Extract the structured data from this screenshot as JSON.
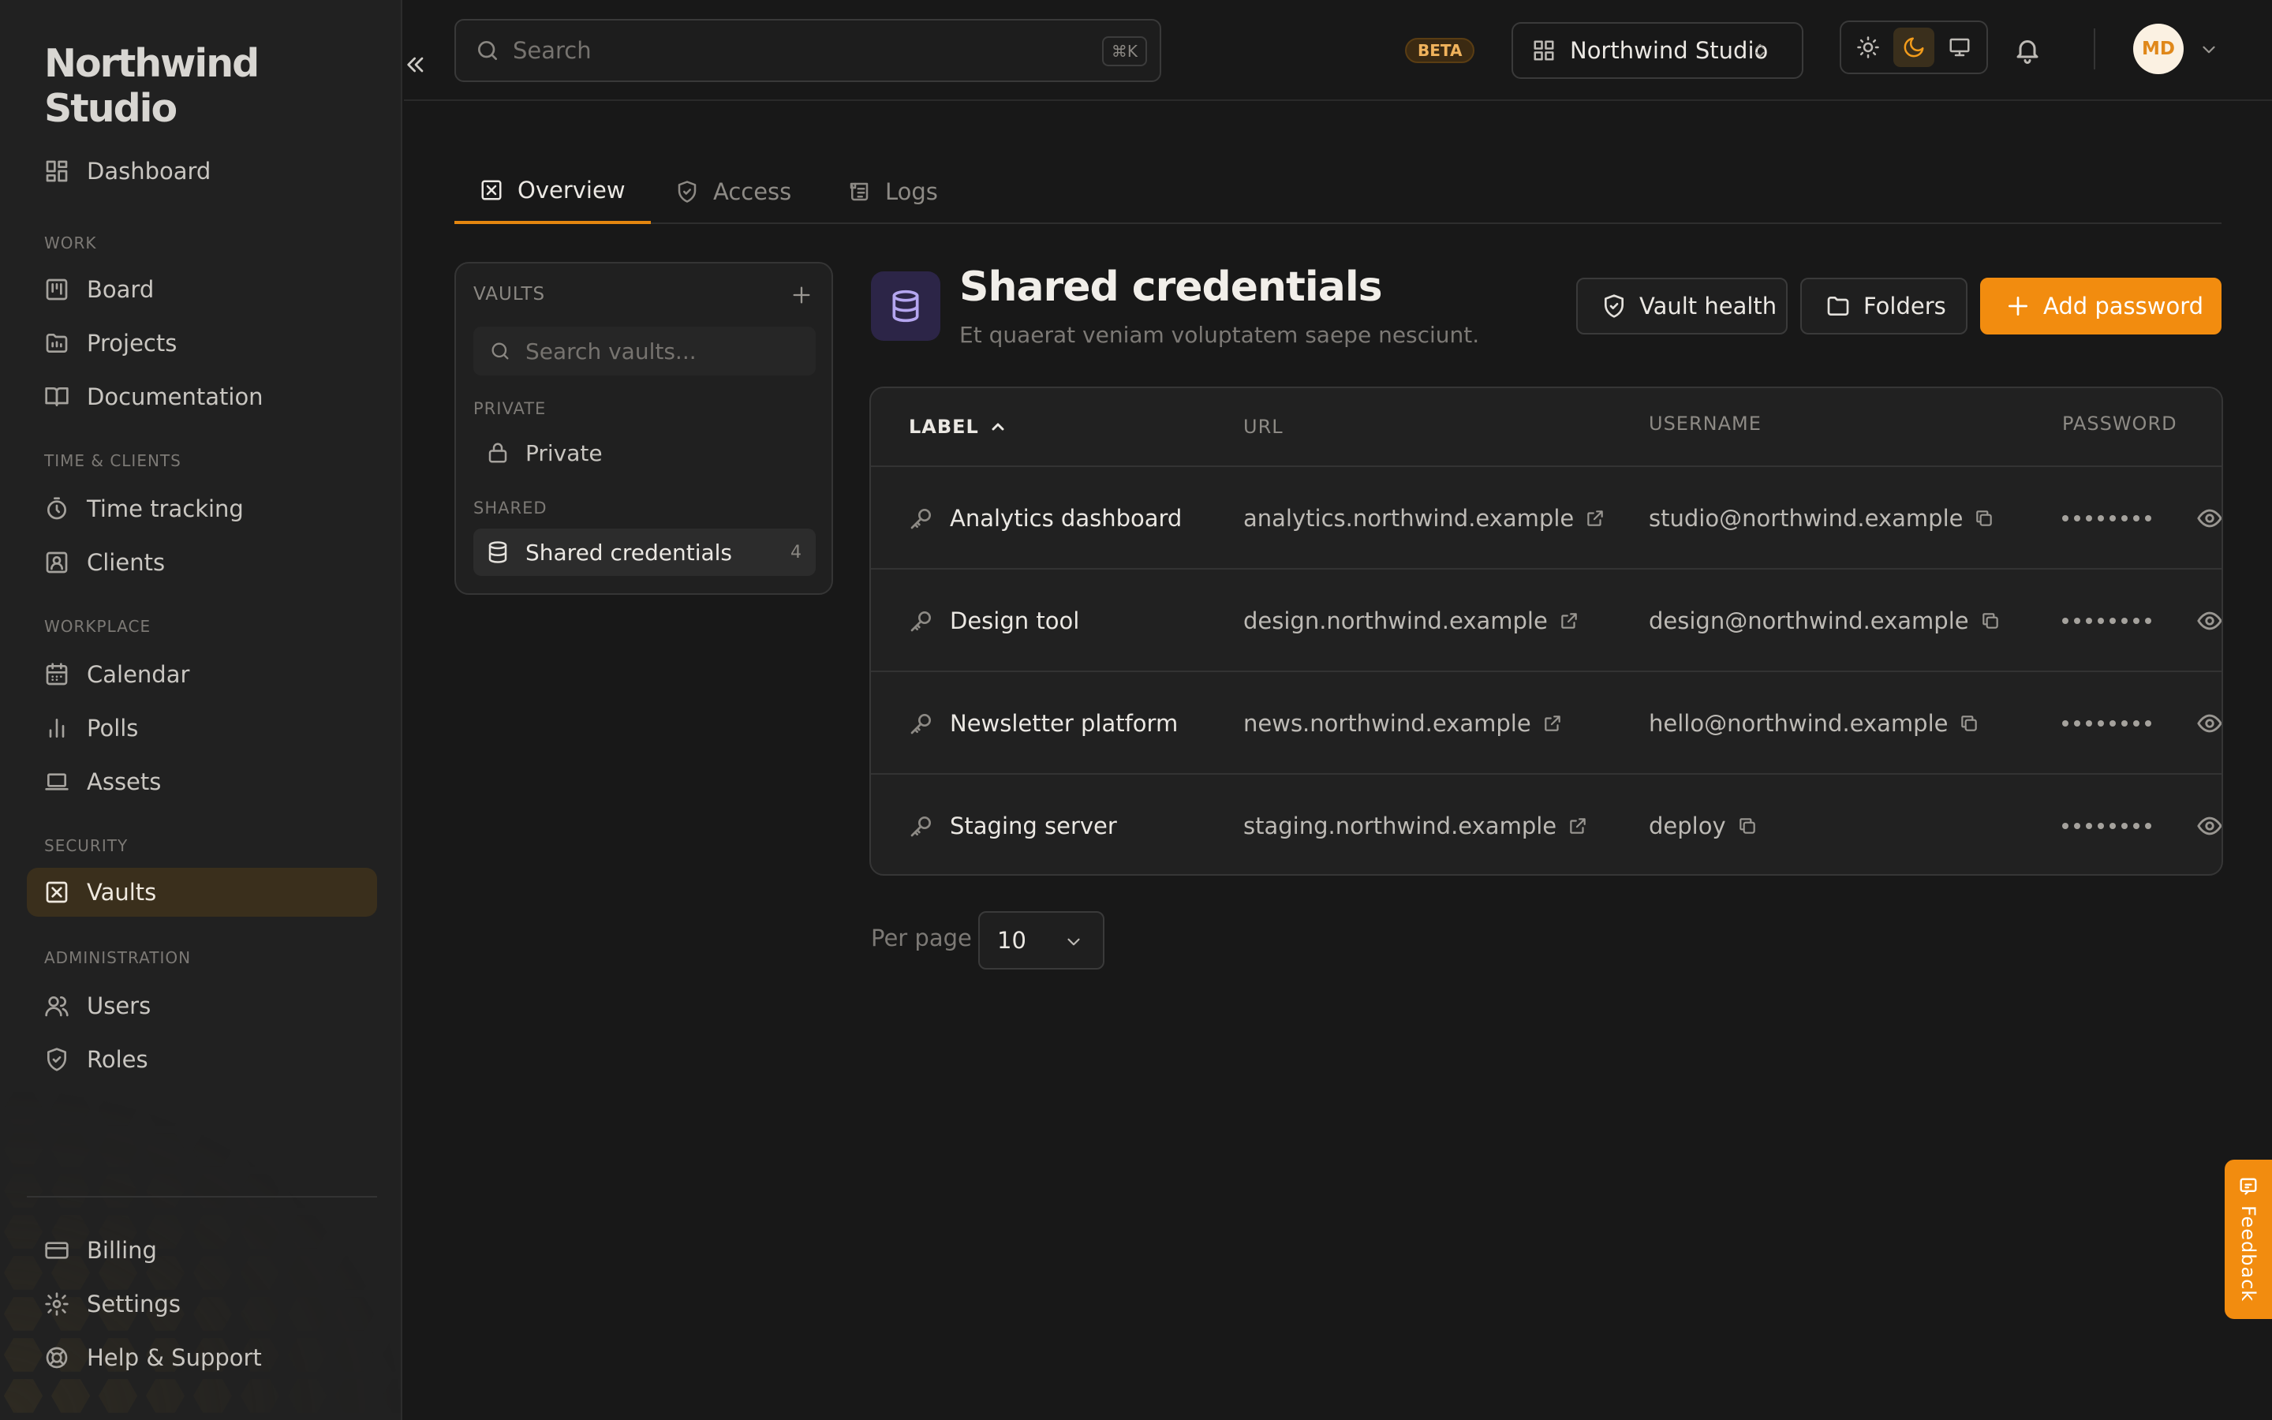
{
  "app": {
    "brand": "Northwind Studio"
  },
  "sidebar": {
    "top_items": [
      {
        "label": "Dashboard",
        "icon": "dashboard-icon"
      }
    ],
    "sections": [
      {
        "title": "WORK",
        "items": [
          {
            "label": "Board",
            "icon": "board-icon"
          },
          {
            "label": "Projects",
            "icon": "folder-icon"
          },
          {
            "label": "Documentation",
            "icon": "book-icon"
          }
        ]
      },
      {
        "title": "TIME & CLIENTS",
        "items": [
          {
            "label": "Time tracking",
            "icon": "stopwatch-icon"
          },
          {
            "label": "Clients",
            "icon": "client-icon"
          }
        ]
      },
      {
        "title": "WORKPLACE",
        "items": [
          {
            "label": "Calendar",
            "icon": "calendar-icon"
          },
          {
            "label": "Polls",
            "icon": "bar-chart-icon"
          },
          {
            "label": "Assets",
            "icon": "laptop-icon"
          }
        ]
      },
      {
        "title": "SECURITY",
        "items": [
          {
            "label": "Vaults",
            "icon": "vault-icon",
            "active": true
          }
        ]
      },
      {
        "title": "ADMINISTRATION",
        "items": [
          {
            "label": "Users",
            "icon": "users-icon"
          },
          {
            "label": "Roles",
            "icon": "shield-icon"
          }
        ]
      }
    ],
    "bottom_items": [
      {
        "label": "Billing",
        "icon": "credit-card-icon"
      },
      {
        "label": "Settings",
        "icon": "gear-icon"
      },
      {
        "label": "Help & Support",
        "icon": "lifebuoy-icon"
      }
    ]
  },
  "header": {
    "search_placeholder": "Search",
    "search_shortcut": "⌘K",
    "beta_badge": "BETA",
    "workspace": "Northwind Studio",
    "theme_options": [
      "light",
      "dark",
      "system"
    ],
    "theme_selected": "dark",
    "avatar_initials": "MD"
  },
  "tabs": [
    {
      "label": "Overview",
      "icon": "vault-icon",
      "active": true
    },
    {
      "label": "Access",
      "icon": "shield-icon"
    },
    {
      "label": "Logs",
      "icon": "scroll-icon"
    }
  ],
  "vault_panel": {
    "title": "VAULTS",
    "search_placeholder": "Search vaults...",
    "sections": [
      {
        "title": "PRIVATE",
        "items": [
          {
            "label": "Private",
            "icon": "lock-icon"
          }
        ]
      },
      {
        "title": "SHARED",
        "items": [
          {
            "label": "Shared credentials",
            "icon": "database-icon",
            "count": "4",
            "active": true
          }
        ]
      }
    ]
  },
  "vault": {
    "title": "Shared credentials",
    "description": "Et quaerat veniam voluptatem saepe nesciunt.",
    "buttons": {
      "health": "Vault health",
      "folders": "Folders",
      "add": "Add password"
    }
  },
  "table": {
    "columns": {
      "label": "LABEL",
      "url": "URL",
      "username": "USERNAME",
      "password": "PASSWORD"
    },
    "sort": {
      "column": "label",
      "direction": "asc"
    },
    "rows": [
      {
        "label": "Analytics dashboard",
        "url": "analytics.northwind.example",
        "username": "studio@northwind.example",
        "password": "••••••••"
      },
      {
        "label": "Design tool",
        "url": "design.northwind.example",
        "username": "design@northwind.example",
        "password": "••••••••"
      },
      {
        "label": "Newsletter platform",
        "url": "news.northwind.example",
        "username": "hello@northwind.example",
        "password": "••••••••"
      },
      {
        "label": "Staging server",
        "url": "staging.northwind.example",
        "username": "deploy",
        "password": "••••••••"
      }
    ]
  },
  "pagination": {
    "per_page_label": "Per page",
    "per_page": "10"
  },
  "feedback": {
    "label": "Feedback"
  },
  "colors": {
    "accent": "#f28c0f",
    "background": "#181818",
    "sidebar": "#212121",
    "active_nav": "#3a2f1c"
  }
}
